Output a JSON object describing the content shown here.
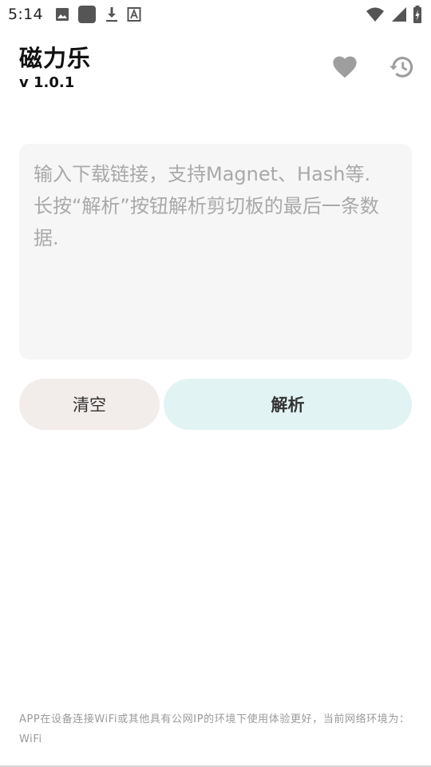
{
  "status_bar": {
    "time": "5:14",
    "left_icons": [
      "image-icon",
      "app-square-icon",
      "download-icon",
      "font-a-icon"
    ],
    "right_icons": [
      "wifi-icon",
      "signal-icon",
      "battery-charging-icon"
    ]
  },
  "header": {
    "title": "磁力乐",
    "version": "v 1.0.1",
    "actions": [
      "heart-icon",
      "history-icon"
    ]
  },
  "input": {
    "value": "",
    "placeholder": "输入下载链接，支持Magnet、Hash等.\n长按“解析”按钮解析剪切板的最后一条数据."
  },
  "buttons": {
    "clear_label": "清空",
    "parse_label": "解析"
  },
  "footer": {
    "note": "APP在设备连接WiFi或其他具有公网IP的环境下使用体验更好，当前网络环境为：WiFi"
  },
  "colors": {
    "clear_button_bg": "#f2eceb",
    "parse_button_bg": "#e1f4f3",
    "input_bg": "#f6f6f6",
    "icon_gray": "#9e9e9e"
  }
}
